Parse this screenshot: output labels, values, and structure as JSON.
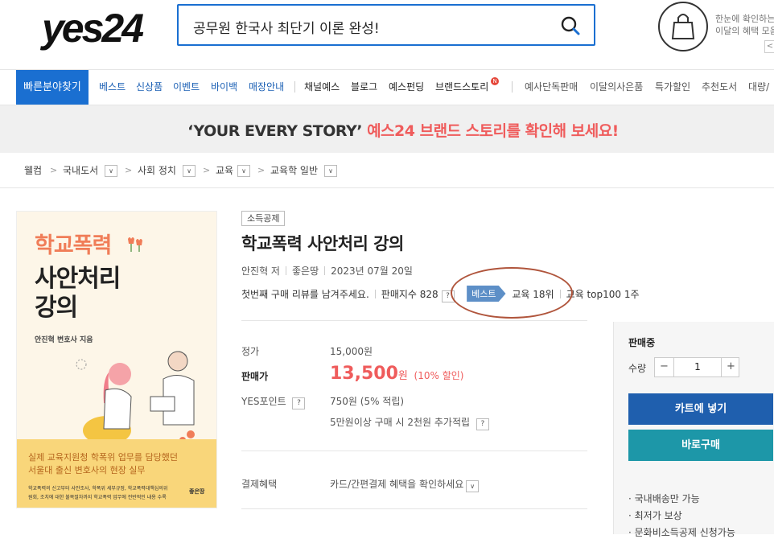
{
  "header": {
    "logo": "yes24",
    "search_value": "공무원 한국사 최단기 이론 완성!",
    "promo_line1": "한눈에 확인하는",
    "promo_line2": "이달의 혜택 모음",
    "promo_arrow": "<"
  },
  "nav": {
    "quick_find": "빠른분야찾기",
    "blue_items": [
      "베스트",
      "신상품",
      "이벤트",
      "바이백",
      "매장안내"
    ],
    "dark_items": [
      "채널예스",
      "블로그",
      "예스펀딩",
      "브랜드스토리"
    ],
    "new_badge": "N",
    "gray_items": [
      "예사단독판매",
      "이달의사은품",
      "특가할인",
      "추천도서",
      "대량/"
    ]
  },
  "banner": {
    "black_text": "‘YOUR EVERY STORY’",
    "red_text": "예스24 브랜드 스토리를 확인해 보세요!"
  },
  "breadcrumb": [
    "웰컴",
    "국내도서",
    "사회 정치",
    "교육",
    "교육학 일반"
  ],
  "cover": {
    "title_line1": "학교폭력",
    "title_line2": "사안처리",
    "title_line3": "강의",
    "author": "안진혁 변호사 지음",
    "quote1": "실제 교육지원청 학폭위 업무를 담당했던",
    "quote2": "서울대 출신 변호사의 현장 실무",
    "small1": "학교폭력의 신고부터 사안조사, 학폭위 세부규정, 학교폭력대책심의위",
    "small2": "원회, 조치에 대한 불복절차까지 학교폭력 업무에 전반적인 내용 수록",
    "publisher": "좋은땅"
  },
  "product": {
    "tax_badge": "소득공제",
    "title": "학교폭력 사안처리 강의",
    "author": "안진혁 저",
    "publisher": "좋은땅",
    "date": "2023년 07월 20일",
    "review_prompt": "첫번째 구매 리뷰를 남겨주세요.",
    "sales_index": "판매지수 828",
    "best_tag": "베스트",
    "rank1": "교육 18위",
    "rank2": "교육 top100 1주",
    "help": "?"
  },
  "price": {
    "list_label": "정가",
    "list_value": "15,000원",
    "sale_label": "판매가",
    "sale_value": "13,500",
    "sale_unit": "원",
    "sale_discount": "(10% 할인)",
    "point_label": "YES포인트",
    "point_value": "750원 (5% 적립)",
    "point_extra": "5만원이상 구매 시 2천원 추가적립",
    "pay_label": "결제혜택",
    "pay_value": "카드/간편결제 혜택을 확인하세요"
  },
  "buy": {
    "status": "판매중",
    "qty_label": "수량",
    "qty_minus": "−",
    "qty_value": "1",
    "qty_plus": "+",
    "cart_label": "카트에 넣기",
    "buy_label": "바로구매",
    "benefits": [
      "· 국내배송만 가능",
      "· 최저가 보상",
      "· 문화비소득공제 신청가능"
    ]
  }
}
